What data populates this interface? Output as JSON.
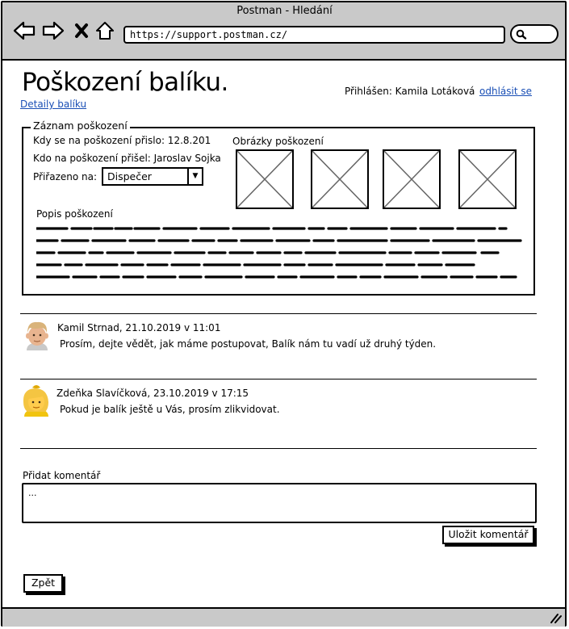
{
  "window": {
    "title": "Postman - Hledání"
  },
  "browser": {
    "url": "https://support.postman.cz/"
  },
  "page": {
    "title": "Poškození balíku.",
    "details_link": "Detaily balíku",
    "logged_in_label": "Přihlášen: Kamila Lotáková",
    "logout_link": "odhlásit se"
  },
  "record": {
    "legend": "Záznam poškození",
    "when_text": "Kdy se na poškození přislo: 12.8.201",
    "who_text": "Kdo na poškození přišel: Jaroslav Sojka",
    "assigned_label": "Přiřazeno na:",
    "assigned_value": "Dispečer",
    "images_label": "Obrázky poškození",
    "description_label": "Popis poškození"
  },
  "comments": [
    {
      "author": "Kamil Strnad, 21.10.2019 v 11:01",
      "text": "Prosím, dejte vědět, jak máme postupovat, Balík nám tu vadí už druhý týden.",
      "avatar_icon": "male-avatar-icon"
    },
    {
      "author": "Zdeňka Slavíčková, 23.10.2019 v 17:15",
      "text": "Pokud je balík ještě u Vás, prosím zlikvidovat.",
      "avatar_icon": "female-avatar-icon"
    }
  ],
  "add_comment": {
    "label": "Přidat komentář",
    "placeholder": "...",
    "save_button": "Uložit komentář"
  },
  "back_button": "Zpět",
  "colors": {
    "chrome": "#c9c9c9",
    "link": "#1a4fb5"
  }
}
